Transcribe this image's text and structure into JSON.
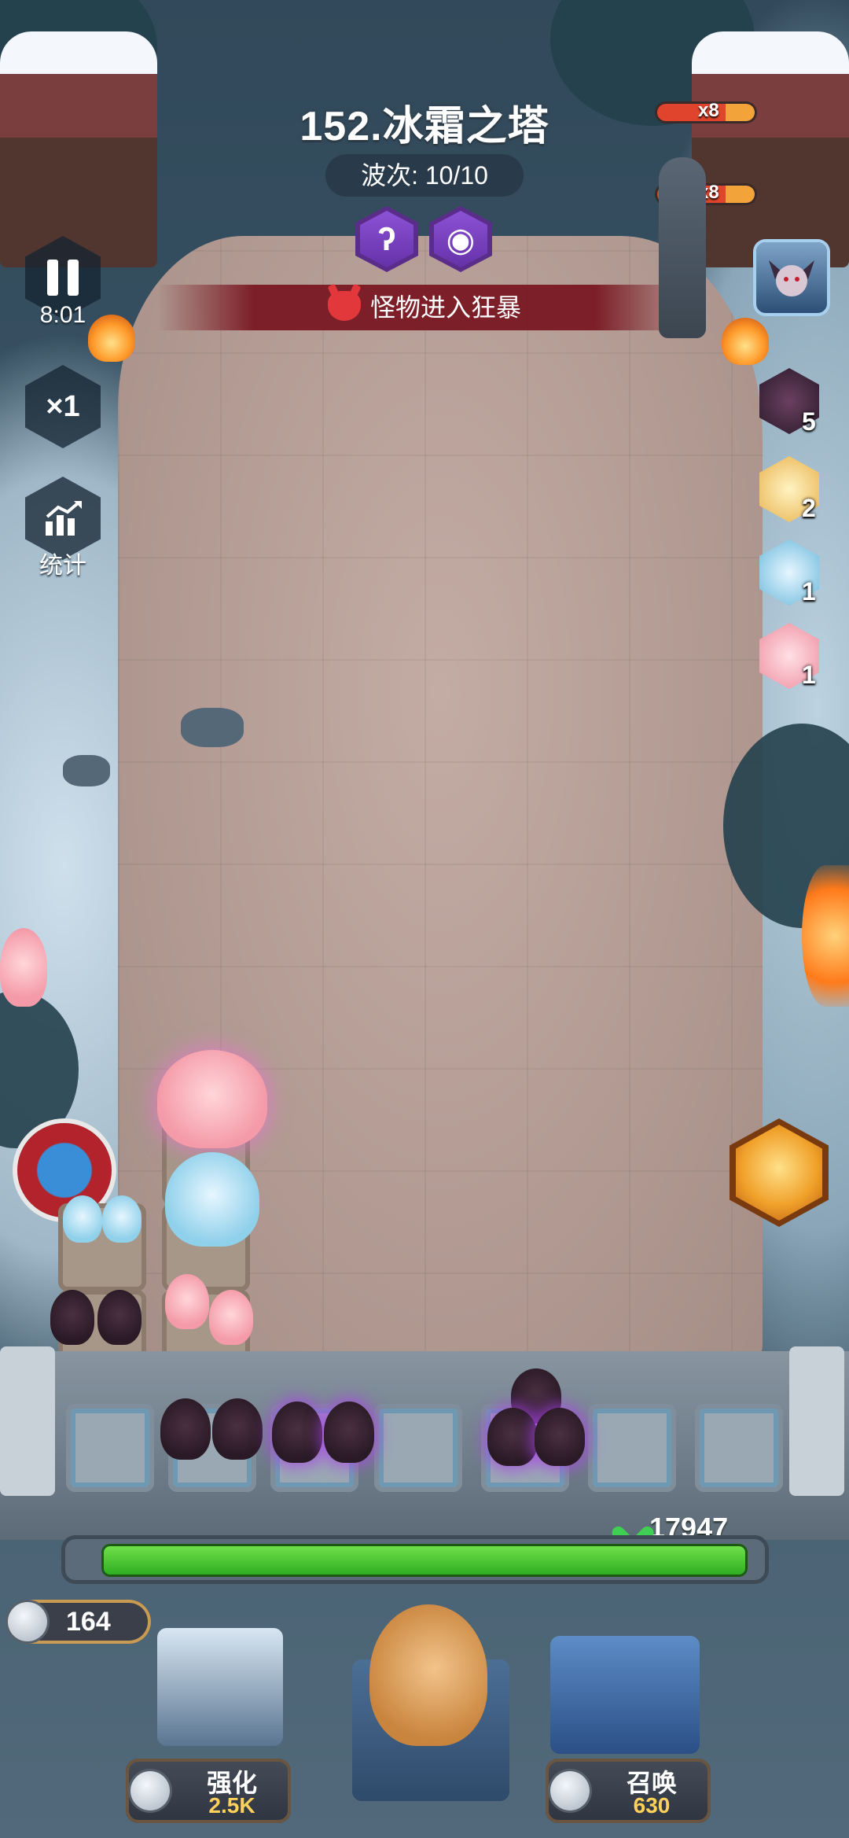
{
  "level": {
    "title": "152.冰霜之塔",
    "wave_label": "波次: 10/10"
  },
  "status": {
    "rage_text": "怪物进入狂暴"
  },
  "hud": {
    "timer": "8:01",
    "speed": "×1",
    "stats_label": "统计"
  },
  "enemies": {
    "bar1_count": "x8",
    "bar2_count": "x8"
  },
  "roster": [
    {
      "name": "dark-cat-hero",
      "count": "5"
    },
    {
      "name": "blonde-hero",
      "count": "2"
    },
    {
      "name": "ice-cat-hero",
      "count": "1"
    },
    {
      "name": "pink-cat-hero",
      "count": "1"
    }
  ],
  "wall": {
    "hp": "17947"
  },
  "resources": {
    "coins": "164"
  },
  "actions": {
    "upgrade_label": "强化",
    "upgrade_cost": "2.5K",
    "summon_label": "召唤",
    "summon_cost": "630"
  },
  "skills": {
    "skill1_icon": "staff-icon",
    "skill2_icon": "eye-icon",
    "pause_icon": "pause-icon",
    "stats_icon": "chart-icon"
  }
}
